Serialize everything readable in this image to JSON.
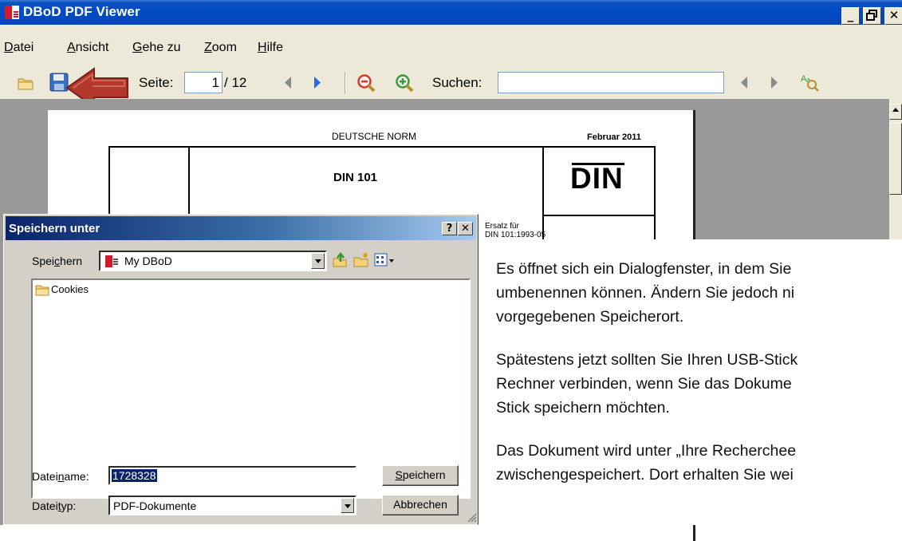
{
  "window": {
    "title": "DBoD PDF Viewer",
    "btn_minimize": "_",
    "btn_maximize": "▫",
    "btn_close": "✕"
  },
  "menu": [
    {
      "pre": "",
      "mn": "D",
      "post": "atei"
    },
    {
      "pre": "",
      "mn": "A",
      "post": "nsicht"
    },
    {
      "pre": "",
      "mn": "G",
      "post": "ehe zu"
    },
    {
      "pre": "",
      "mn": "Z",
      "post": "oom"
    },
    {
      "pre": "",
      "mn": "H",
      "post": "ilfe"
    }
  ],
  "toolbar": {
    "page_label": "Seite:",
    "page_value": "1",
    "page_total": "/ 12",
    "search_label": "Suchen:",
    "search_value": ""
  },
  "document": {
    "header_left": "DEUTSCHE NORM",
    "header_right": "Februar 2011",
    "norm_number": "DIN 101",
    "logo": "DIN",
    "replaces_line1": "Ersatz für",
    "replaces_line2": "DIN 101:1993-05"
  },
  "dialog": {
    "title": "Speichern unter",
    "help_btn": "?",
    "close_btn": "✕",
    "save_in_label_pre": "Spei",
    "save_in_label_mn": "c",
    "save_in_label_post": "hern",
    "save_in_value": "My DBoD",
    "files": [
      {
        "name": "Cookies"
      }
    ],
    "filename_label_pre": "Datei",
    "filename_label_mn": "n",
    "filename_label_post": "ame:",
    "filename_value": "1728328",
    "filetype_label_pre": "Datei",
    "filetype_label_mn": "t",
    "filetype_label_post": "yp:",
    "filetype_value": "PDF-Dokumente",
    "save_btn_mn": "S",
    "save_btn_post": "peichern",
    "cancel_btn": "Abbrechen"
  },
  "help_text": {
    "p1": [
      "Es öffnet sich ein Dialogfenster, in dem Sie",
      "umbenennen können. Ändern Sie jedoch ni",
      "vorgegebenen Speicherort."
    ],
    "p2": [
      "Spätestens jetzt sollten Sie Ihren USB-Stick",
      "Rechner verbinden, wenn Sie das Dokume",
      "Stick speichern möchten."
    ],
    "p3": [
      "Das Dokument wird unter „Ihre Rechercheе",
      "zwischengespeichert. Dort erhalten Sie wei"
    ]
  },
  "colors": {
    "arrow": "#b03a2e",
    "titlebar": "#0049c2",
    "dialog_title": "#0a246a"
  }
}
